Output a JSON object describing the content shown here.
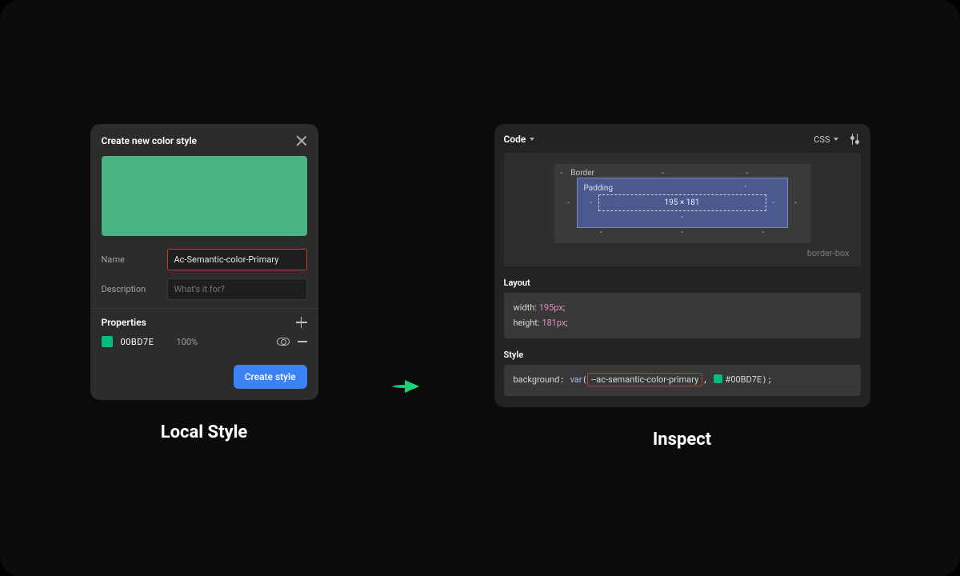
{
  "local_style": {
    "title": "Create new color style",
    "swatch_color": "#49b383",
    "fields": {
      "name_label": "Name",
      "name_value": "Ac-Semantic-color-Primary",
      "desc_label": "Description",
      "desc_placeholder": "What's it for?"
    },
    "properties": {
      "header": "Properties",
      "items": [
        {
          "hex": "00BD7E",
          "opacity": "100%",
          "color": "#00bd7e"
        }
      ]
    },
    "create_button": "Create style",
    "caption": "Local Style"
  },
  "inspect": {
    "tab": "Code",
    "lang": "CSS",
    "box_model": {
      "border_label": "Border",
      "padding_label": "Padding",
      "content": "195 × 181",
      "dash": "-",
      "sizing": "border-box"
    },
    "layout": {
      "label": "Layout",
      "css": {
        "width_prop": "width",
        "width_val": "195px",
        "height_prop": "height",
        "height_val": "181px"
      }
    },
    "style": {
      "label": "Style",
      "css": {
        "prop": "background",
        "fn": "var",
        "var_name": "--ac-semantic-color-primary",
        "hex": "#00BD7E",
        "swatch_color": "#00bd7e"
      }
    },
    "caption": "Inspect"
  }
}
